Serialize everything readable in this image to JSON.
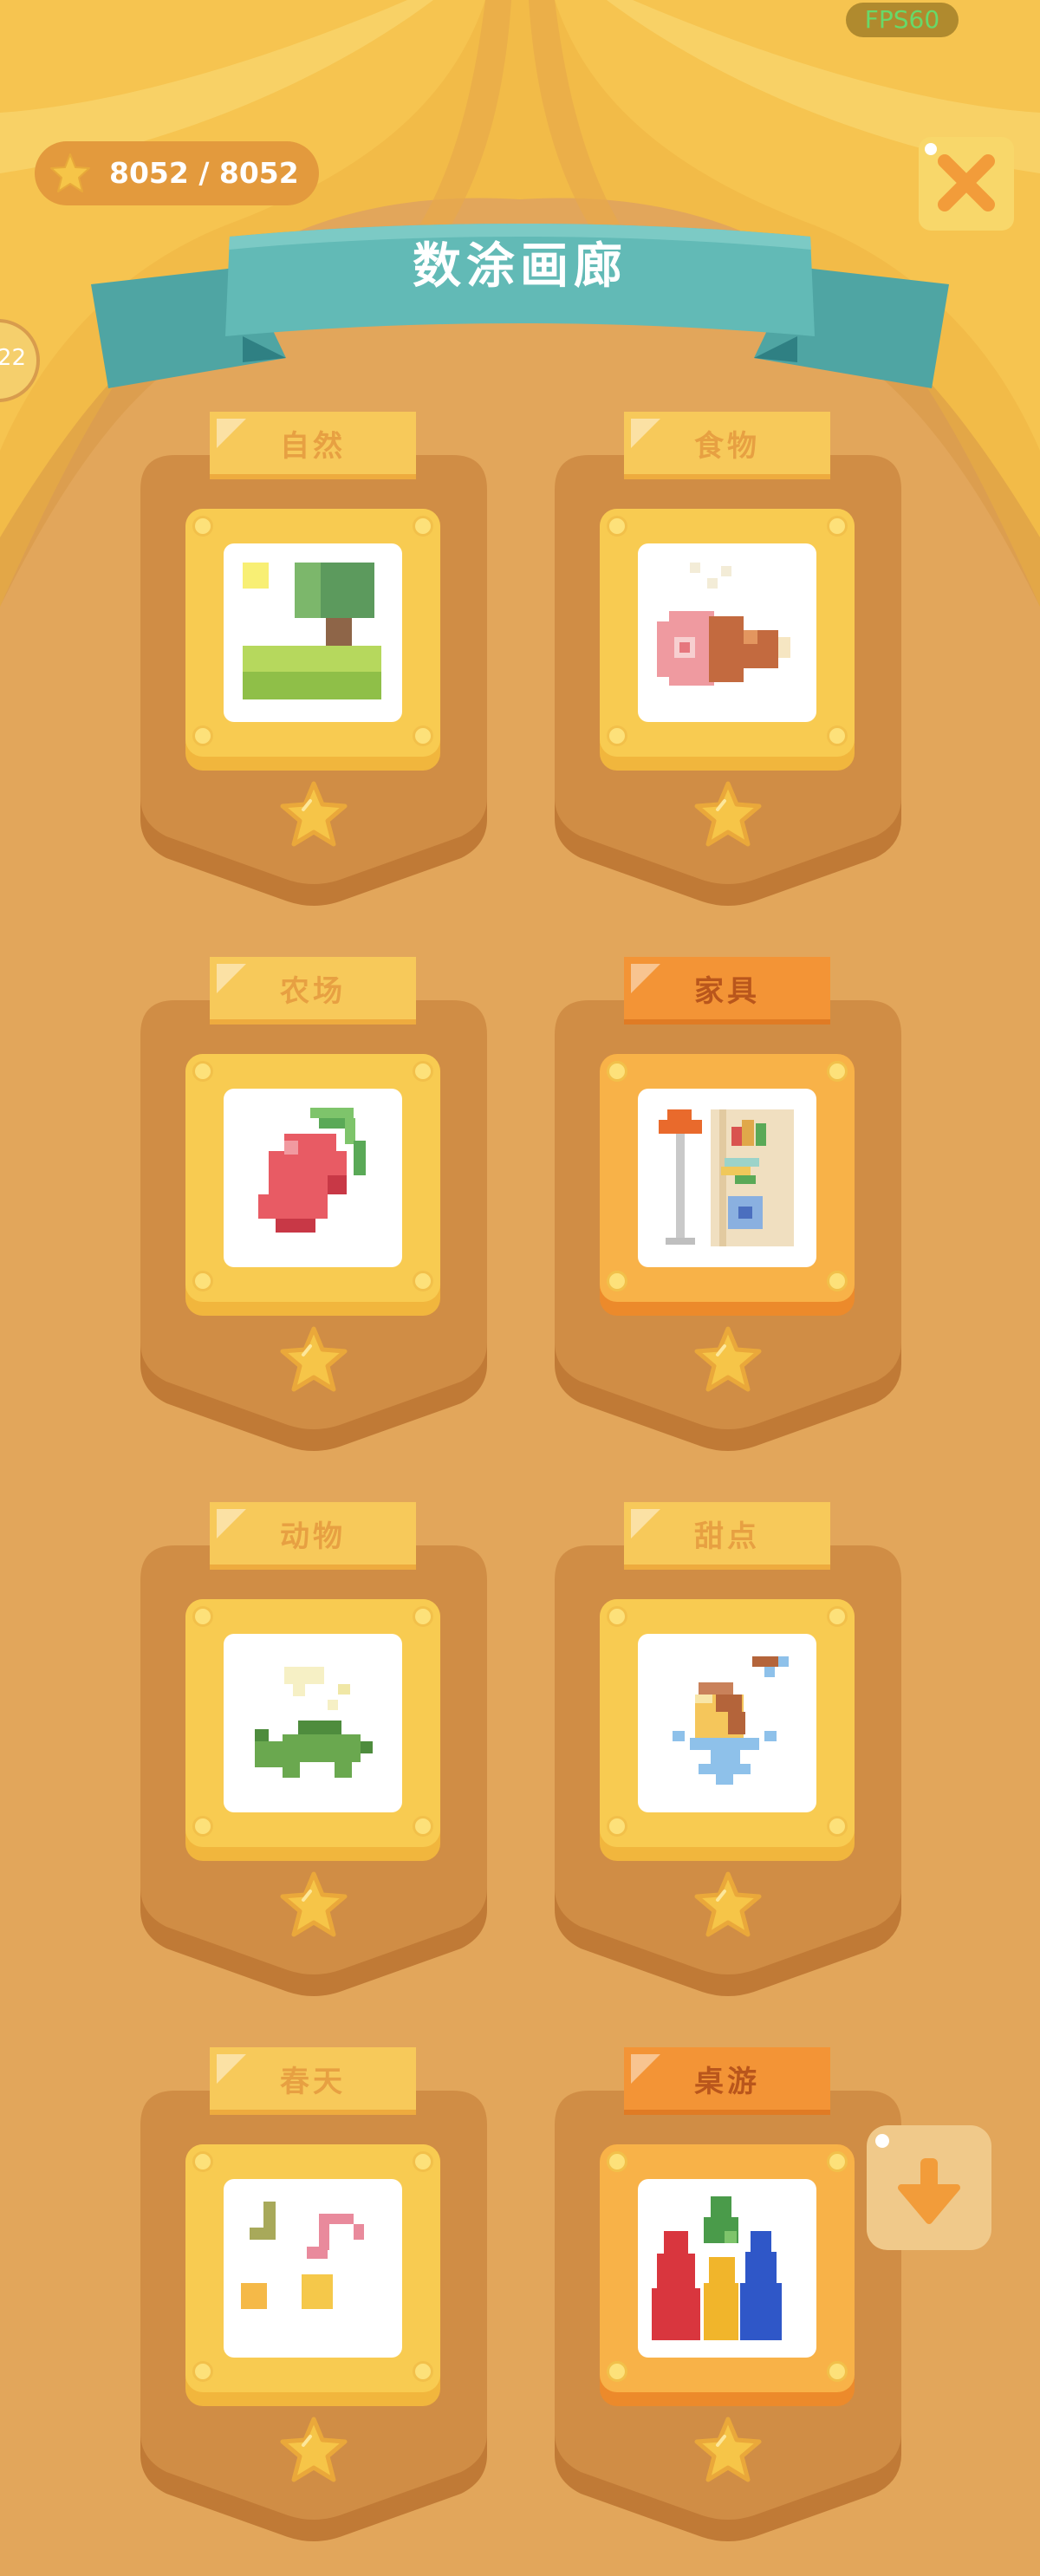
{
  "hud": {
    "fps": "FPS60",
    "score": "8052 / 8052",
    "score_icon": "star-icon",
    "close_icon": "close-icon",
    "scroll_icon": "arrow-down-icon",
    "side_badge": "22"
  },
  "title": "数涂画廊",
  "colors": {
    "background": "#e2a65b",
    "curtain": "#f2bb48",
    "banner": "#5fb7b3",
    "card_shield": "#cf8940",
    "tab_yellow": "#f7c95a",
    "tab_orange": "#f39436"
  },
  "categories": [
    {
      "label": "自然",
      "highlight": false,
      "icon": "nature-tree-pixel-icon"
    },
    {
      "label": "食物",
      "highlight": false,
      "icon": "food-ham-pixel-icon"
    },
    {
      "label": "农场",
      "highlight": false,
      "icon": "farm-chili-pixel-icon"
    },
    {
      "label": "家具",
      "highlight": true,
      "icon": "furniture-shelf-pixel-icon"
    },
    {
      "label": "动物",
      "highlight": false,
      "icon": "animal-turtle-pixel-icon"
    },
    {
      "label": "甜点",
      "highlight": false,
      "icon": "dessert-icecream-pixel-icon"
    },
    {
      "label": "春天",
      "highlight": false,
      "icon": "spring-music-pixel-icon"
    },
    {
      "label": "桌游",
      "highlight": true,
      "icon": "boardgame-pieces-pixel-icon"
    }
  ]
}
